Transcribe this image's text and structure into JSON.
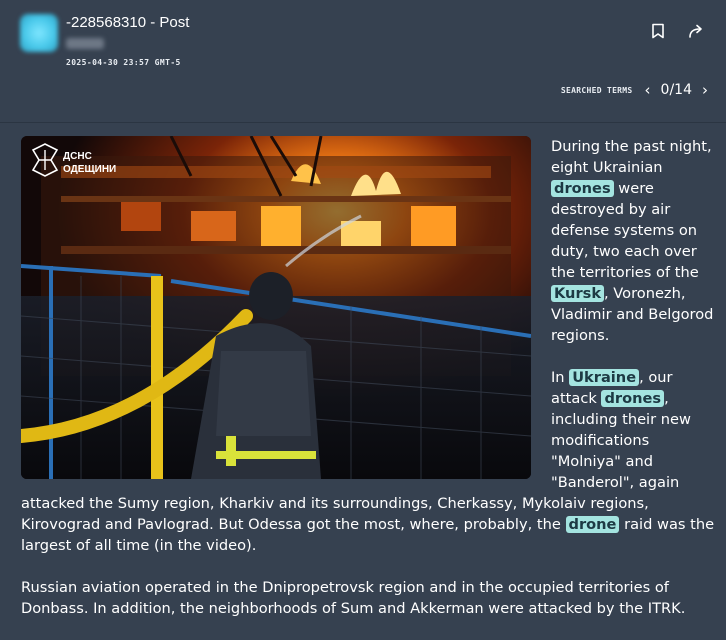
{
  "post": {
    "title": "-228568310 - Post",
    "timestamp": "2025-04-30 23:57 GMT-5"
  },
  "toolbar": {
    "bookmark_icon": "bookmark-icon",
    "share_icon": "share-arrow-icon"
  },
  "search": {
    "label": "SEARCHED TERMS",
    "prev": "‹",
    "next": "›",
    "counter": "0/14"
  },
  "image": {
    "watermark_line1": "ДСНС",
    "watermark_line2": "ОДЕЩИНИ"
  },
  "body": {
    "p1": [
      {
        "t": "During the past night, eight Ukrainian "
      },
      {
        "t": "drones",
        "hl": true
      },
      {
        "t": " were destroyed by air defense systems on duty, two each over the territories of the "
      },
      {
        "t": "Kursk",
        "hl": true
      },
      {
        "t": ", Voronezh, Vladimir and Belgorod regions."
      }
    ],
    "p2": [
      {
        "t": "In "
      },
      {
        "t": "Ukraine",
        "hl": true
      },
      {
        "t": ", our attack "
      },
      {
        "t": "drones",
        "hl": true
      },
      {
        "t": ", including their new modifications \"Molniya\" and \"Banderol\", again attacked the Sumy region, Kharkiv and its surroundings, Cherkassy, Mykolaiv regions, Kirovograd and Pavlograd. But Odessa got the most, where, probably, the "
      },
      {
        "t": "drone",
        "hl": true
      },
      {
        "t": " raid was the largest of all time (in the video)."
      }
    ],
    "p3": [
      {
        "t": "Russian aviation operated in the Dnipropetrovsk region and in the occupied territories of Donbass. In addition, the neighborhoods of Sum and Akkerman were attacked by the ITRK."
      }
    ]
  },
  "colors": {
    "background": "#364150",
    "highlight": "#a4e4e0",
    "highlight_text": "#1d3a44"
  }
}
